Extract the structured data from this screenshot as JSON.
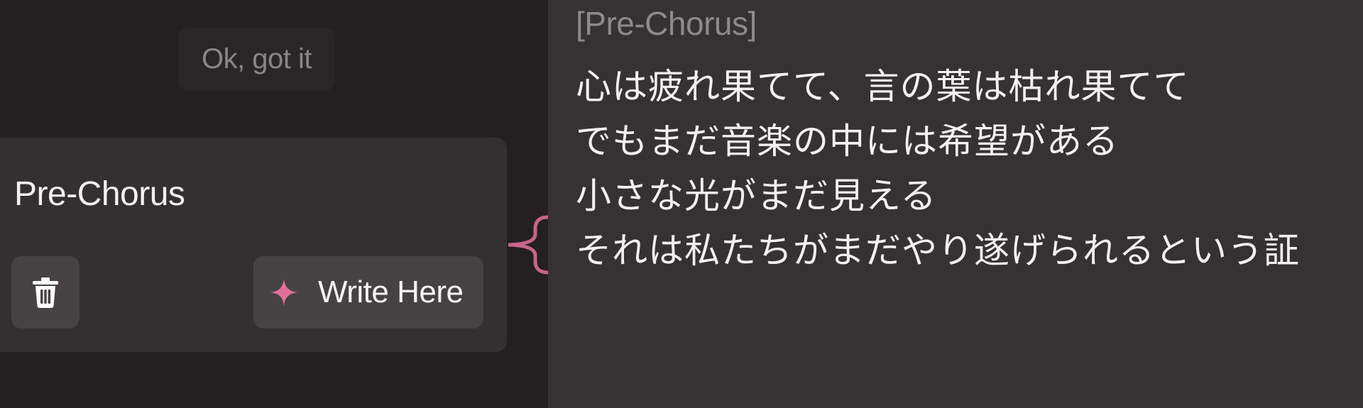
{
  "tooltip": {
    "dismiss_label": "Ok, got it"
  },
  "section": {
    "title": "Pre-Chorus",
    "write_label": "Write Here"
  },
  "icons": {
    "delete": "trash-icon",
    "write": "sparkle-icon",
    "connector": "curly-bracket-icon"
  },
  "colors": {
    "accent": "#e0709a"
  },
  "lyrics": {
    "heading": "[Pre-Chorus]",
    "lines": [
      "心は疲れ果てて、言の葉は枯れ果てて",
      "でもまだ音楽の中には希望がある",
      "小さな光がまだ見える",
      "それは私たちがまだやり遂げられるという証"
    ]
  }
}
